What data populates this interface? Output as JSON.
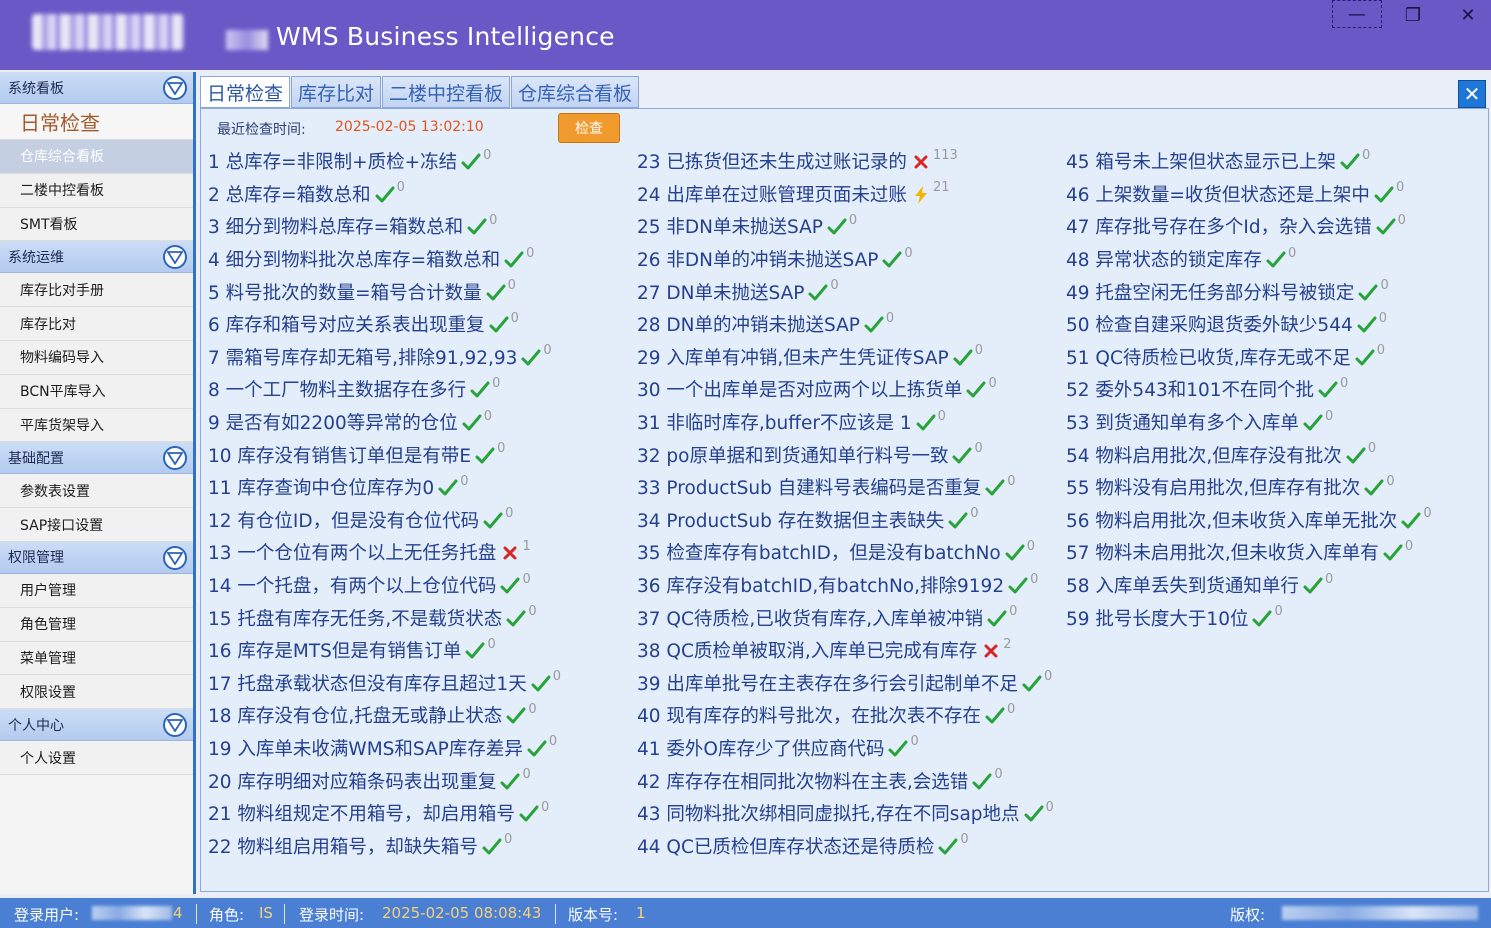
{
  "window": {
    "title": "WMS Business Intelligence",
    "controls": {
      "minimize": "—",
      "maximize": "❐",
      "close": "✕"
    }
  },
  "sidebar": {
    "groups": [
      {
        "label": "系统看板",
        "items": [
          "日常检查",
          "仓库综合看板",
          "二楼中控看板",
          "SMT看板"
        ]
      },
      {
        "label": "系统运维",
        "items": [
          "库存比对手册",
          "库存比对",
          "物料编码导入",
          "BCN平库导入",
          "平库货架导入"
        ]
      },
      {
        "label": "基础配置",
        "items": [
          "参数表设置",
          "SAP接口设置"
        ]
      },
      {
        "label": "权限管理",
        "items": [
          "用户管理",
          "角色管理",
          "菜单管理",
          "权限设置"
        ]
      },
      {
        "label": "个人中心",
        "items": [
          "个人设置"
        ]
      }
    ]
  },
  "tabs": [
    "日常检查",
    "库存比对",
    "二楼中控看板",
    "仓库综合看板"
  ],
  "tab_close": "✕",
  "panel": {
    "last_check_label": "最近检查时间:",
    "last_check_time": "2025-02-05 13:02:10",
    "check_button": "检查"
  },
  "checks": [
    {
      "text": "1 总库存=非限制+质检+冻结",
      "status": "ok",
      "count": "0"
    },
    {
      "text": "2 总库存=箱数总和",
      "status": "ok",
      "count": "0"
    },
    {
      "text": "3 细分到物料总库存=箱数总和",
      "status": "ok",
      "count": "0"
    },
    {
      "text": "4 细分到物料批次总库存=箱数总和",
      "status": "ok",
      "count": "0"
    },
    {
      "text": "5 料号批次的数量=箱号合计数量",
      "status": "ok",
      "count": "0"
    },
    {
      "text": "6 库存和箱号对应关系表出现重复",
      "status": "ok",
      "count": "0"
    },
    {
      "text": "7 需箱号库存却无箱号,排除91,92,93",
      "status": "ok",
      "count": "0"
    },
    {
      "text": "8 一个工厂物料主数据存在多行",
      "status": "ok",
      "count": "0"
    },
    {
      "text": "9 是否有如2200等异常的仓位",
      "status": "ok",
      "count": "0"
    },
    {
      "text": "10 库存没有销售订单但是有带E",
      "status": "ok",
      "count": "0"
    },
    {
      "text": "11 库存查询中仓位库存为0",
      "status": "ok",
      "count": "0"
    },
    {
      "text": "12 有仓位ID，但是没有仓位代码",
      "status": "ok",
      "count": "0"
    },
    {
      "text": "13 一个仓位有两个以上无任务托盘",
      "status": "error",
      "count": "1"
    },
    {
      "text": "14 一个托盘，有两个以上仓位代码",
      "status": "ok",
      "count": "0"
    },
    {
      "text": "15 托盘有库存无任务,不是载货状态",
      "status": "ok",
      "count": "0"
    },
    {
      "text": "16 库存是MTS但是有销售订单",
      "status": "ok",
      "count": "0"
    },
    {
      "text": "17 托盘承载状态但没有库存且超过1天",
      "status": "ok",
      "count": "0"
    },
    {
      "text": "18 库存没有仓位,托盘无或静止状态",
      "status": "ok",
      "count": "0"
    },
    {
      "text": "19 入库单未收满WMS和SAP库存差异",
      "status": "ok",
      "count": "0"
    },
    {
      "text": "20 库存明细对应箱条码表出现重复",
      "status": "ok",
      "count": "0"
    },
    {
      "text": "21 物料组规定不用箱号，却启用箱号",
      "status": "ok",
      "count": "0"
    },
    {
      "text": "22 物料组启用箱号，却缺失箱号",
      "status": "ok",
      "count": "0"
    },
    {
      "text": "23 已拣货但还未生成过账记录的",
      "status": "error",
      "count": "113"
    },
    {
      "text": "24 出库单在过账管理页面未过账",
      "status": "warn",
      "count": "21"
    },
    {
      "text": "25 非DN单未抛送SAP",
      "status": "ok",
      "count": "0"
    },
    {
      "text": "26 非DN单的冲销未抛送SAP",
      "status": "ok",
      "count": "0"
    },
    {
      "text": "27 DN单未抛送SAP",
      "status": "ok",
      "count": "0"
    },
    {
      "text": "28 DN单的冲销未抛送SAP",
      "status": "ok",
      "count": "0"
    },
    {
      "text": "29 入库单有冲销,但未产生凭证传SAP",
      "status": "ok",
      "count": "0"
    },
    {
      "text": "30 一个出库单是否对应两个以上拣货单",
      "status": "ok",
      "count": "0"
    },
    {
      "text": "31 非临时库存,buffer不应该是 1",
      "status": "ok",
      "count": "0"
    },
    {
      "text": "32 po原单据和到货通知单行料号一致",
      "status": "ok",
      "count": "0"
    },
    {
      "text": "33 ProductSub 自建料号表编码是否重复",
      "status": "ok",
      "count": "0"
    },
    {
      "text": "34 ProductSub 存在数据但主表缺失",
      "status": "ok",
      "count": "0"
    },
    {
      "text": "35 检查库存有batchID，但是没有batchNo",
      "status": "ok",
      "count": "0"
    },
    {
      "text": "36 库存没有batchID,有batchNo,排除9192",
      "status": "ok",
      "count": "0"
    },
    {
      "text": "37 QC待质检,已收货有库存,入库单被冲销",
      "status": "ok",
      "count": "0"
    },
    {
      "text": "38 QC质检单被取消,入库单已完成有库存",
      "status": "error",
      "count": "2"
    },
    {
      "text": "39 出库单批号在主表存在多行会引起制单不足",
      "status": "ok",
      "count": "0"
    },
    {
      "text": "40 现有库存的料号批次，在批次表不存在",
      "status": "ok",
      "count": "0"
    },
    {
      "text": "41 委外O库存少了供应商代码",
      "status": "ok",
      "count": "0"
    },
    {
      "text": "42 库存存在相同批次物料在主表,会选错",
      "status": "ok",
      "count": "0"
    },
    {
      "text": "43 同物料批次绑相同虚拟托,存在不同sap地点",
      "status": "ok",
      "count": "0"
    },
    {
      "text": "44 QC已质检但库存状态还是待质检",
      "status": "ok",
      "count": "0"
    },
    {
      "text": "45 箱号未上架但状态显示已上架",
      "status": "ok",
      "count": "0"
    },
    {
      "text": "46 上架数量=收货但状态还是上架中",
      "status": "ok",
      "count": "0"
    },
    {
      "text": "47 库存批号存在多个Id，杂入会选错",
      "status": "ok",
      "count": "0"
    },
    {
      "text": "48 异常状态的锁定库存",
      "status": "ok",
      "count": "0"
    },
    {
      "text": "49 托盘空闲无任务部分料号被锁定",
      "status": "ok",
      "count": "0"
    },
    {
      "text": "50 检查自建采购退货委外缺少544",
      "status": "ok",
      "count": "0"
    },
    {
      "text": "51 QC待质检已收货,库存无或不足",
      "status": "ok",
      "count": "0"
    },
    {
      "text": "52 委外543和101不在同个批",
      "status": "ok",
      "count": "0"
    },
    {
      "text": "53 到货通知单有多个入库单",
      "status": "ok",
      "count": "0"
    },
    {
      "text": "54 物料启用批次,但库存没有批次",
      "status": "ok",
      "count": "0"
    },
    {
      "text": "55 物料没有启用批次,但库存有批次",
      "status": "ok",
      "count": "0"
    },
    {
      "text": "56 物料启用批次,但未收货入库单无批次",
      "status": "ok",
      "count": "0"
    },
    {
      "text": "57 物料未启用批次,但未收货入库单有",
      "status": "ok",
      "count": "0"
    },
    {
      "text": "58 入库单丢失到货通知单行",
      "status": "ok",
      "count": "0"
    },
    {
      "text": "59 批号长度大于10位",
      "status": "ok",
      "count": "0"
    }
  ],
  "statusbar": {
    "user_label": "登录用户:",
    "user_value_suffix": "4",
    "role_label": "角色:",
    "role_value": "IS",
    "login_time_label": "登录时间:",
    "login_time_value": "2025-02-05 08:08:43",
    "version_label": "版本号:",
    "version_value": "1",
    "copyright_label": "版权:"
  },
  "colors": {
    "titlebar": "#6a58c6",
    "ok": "#27a33a",
    "error": "#d82626",
    "warn": "#f5b400",
    "status_value": "#f5d27a"
  }
}
